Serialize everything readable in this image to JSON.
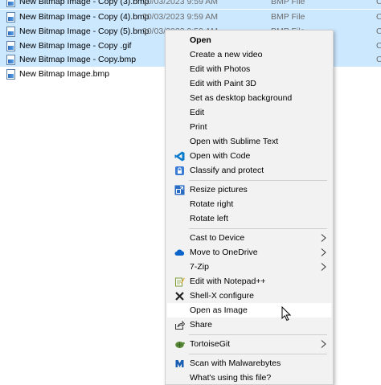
{
  "files": [
    {
      "name": "New Bitmap Image - Copy (3).bmp",
      "date": "20/03/2023 9:59 AM",
      "type": "BMP File",
      "size": "C"
    },
    {
      "name": "New Bitmap Image - Copy (4).bmp",
      "date": "20/03/2023 9:59 AM",
      "type": "BMP File",
      "size": "C"
    },
    {
      "name": "New Bitmap Image - Copy (5).bmp",
      "date": "20/03/2023 9:59 AM",
      "type": "BMP File",
      "size": "C"
    },
    {
      "name": "New Bitmap Image - Copy .gif",
      "date": "",
      "type": "",
      "size": "C"
    },
    {
      "name": "New Bitmap Image - Copy.bmp",
      "date": "",
      "type": "",
      "size": "C"
    },
    {
      "name": "New Bitmap Image.bmp",
      "date": "",
      "type": "",
      "size": ""
    }
  ],
  "menu": {
    "open": "Open",
    "create_video": "Create a new video",
    "edit_photos": "Edit with Photos",
    "edit_paint3d": "Edit with Paint 3D",
    "set_desktop_bg": "Set as desktop background",
    "edit": "Edit",
    "print": "Print",
    "open_sublime": "Open with Sublime Text",
    "open_code": "Open with Code",
    "classify_protect": "Classify and protect",
    "resize_pictures": "Resize pictures",
    "rotate_right": "Rotate right",
    "rotate_left": "Rotate left",
    "cast_device": "Cast to Device",
    "move_onedrive": "Move to OneDrive",
    "seven_zip": "7-Zip",
    "edit_notepadpp": "Edit with Notepad++",
    "shellx_configure": "Shell-X configure",
    "open_as_image": "Open as Image",
    "share": "Share",
    "tortoisegit": "TortoiseGit",
    "scan_malwarebytes": "Scan with Malwarebytes",
    "whats_using": "What's using this file?"
  },
  "colors": {
    "selection": "#cce8ff",
    "menu_background": "#f2f2f2",
    "menu_hover": "#ffffff"
  }
}
